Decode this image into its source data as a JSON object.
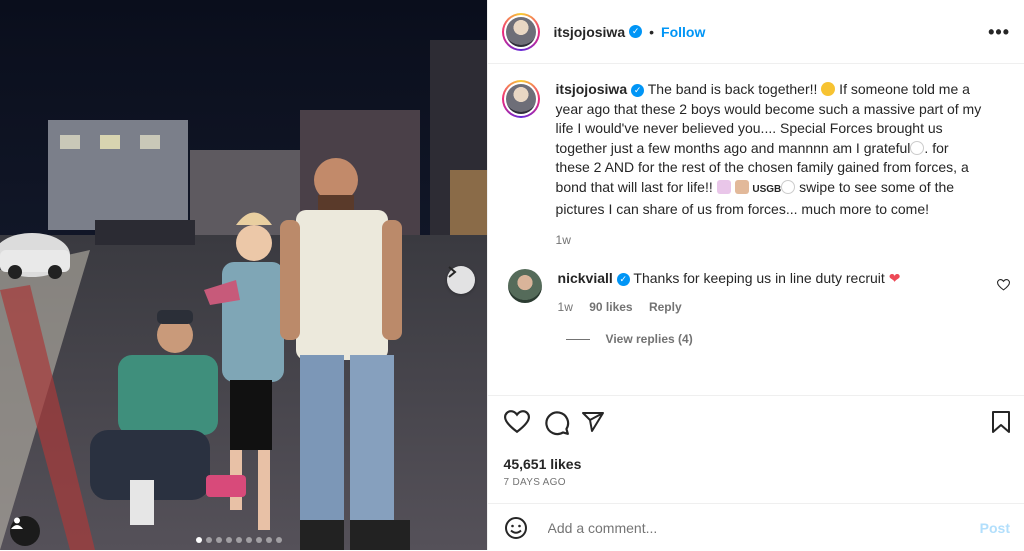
{
  "header": {
    "username": "itsjojosiwa",
    "follow_label": "Follow",
    "separator": "•",
    "more_icon": "more-horizontal-icon"
  },
  "caption": {
    "username": "itsjojosiwa",
    "text_part1": " The band is back together!! ",
    "text_part2": " If someone told me a year ago that these 2 boys would become such a massive part of my life I would've never believed you.... Special Forces brought us together just a few months ago and mannnn am I grateful",
    "text_part3": ". for these 2 AND for the rest of the chosen family gained from forces, a bond that will last for life!! ",
    "usgb": "USGB",
    "text_part4": " swipe to see some of the pictures I can share of us from forces... much more to come!",
    "time": "1w"
  },
  "comment": {
    "username": "nickviall",
    "text": " Thanks for keeping us in line duty recruit ",
    "time": "1w",
    "likes": "90 likes",
    "reply": "Reply",
    "view_replies": "View replies (4)"
  },
  "likes": "45,651 likes",
  "date": "7 DAYS AGO",
  "add_comment": {
    "placeholder": "Add a comment...",
    "post_label": "Post"
  },
  "colors": {
    "accent": "#0095f6",
    "post_disabled": "#b2dffc",
    "text": "#262626",
    "muted": "#737373",
    "heart_red": "#ed4956"
  },
  "carousel": {
    "total_slides": 9,
    "active_index": 0
  }
}
